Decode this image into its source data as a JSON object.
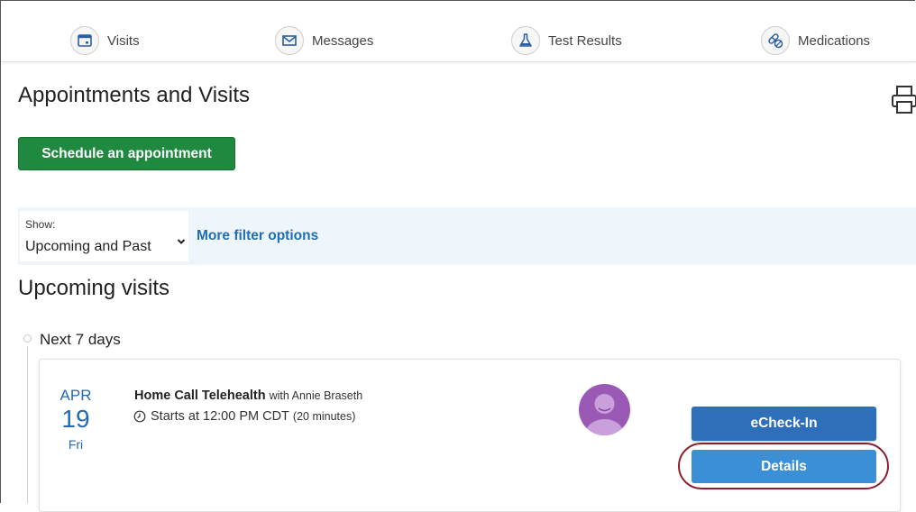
{
  "nav": {
    "items": [
      {
        "label": "Visits",
        "icon": "calendar-icon"
      },
      {
        "label": "Messages",
        "icon": "envelope-icon"
      },
      {
        "label": "Test Results",
        "icon": "flask-icon"
      },
      {
        "label": "Medications",
        "icon": "pills-icon"
      }
    ]
  },
  "header": {
    "title": "Appointments and Visits",
    "print_icon": "printer-icon"
  },
  "actions": {
    "schedule_label": "Schedule an appointment"
  },
  "filter": {
    "show_caption": "Show:",
    "show_value": "Upcoming and Past",
    "more_filters_label": "More filter options"
  },
  "upcoming": {
    "title": "Upcoming visits",
    "group_label": "Next 7 days",
    "visit": {
      "month": "APR",
      "day": "19",
      "weekday": "Fri",
      "type": "Home Call Telehealth",
      "provider_prefix": "with Annie Braseth",
      "start_text": "Starts at 12:00 PM CDT",
      "duration": "(20 minutes)",
      "echeckin_label": "eCheck-In",
      "details_label": "Details"
    }
  },
  "colors": {
    "schedule_green": "#1f8a3f",
    "link_blue": "#1f6eb5",
    "date_blue": "#2569b0",
    "echeckin_blue": "#2d6fb8",
    "details_blue": "#3a8fd6",
    "filter_bg": "#eff6fb",
    "highlight_ring": "#8b1e2b",
    "avatar_purple": "#9b59b6"
  }
}
